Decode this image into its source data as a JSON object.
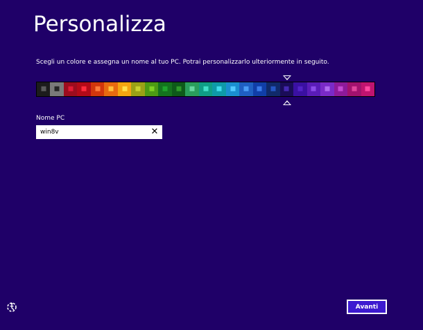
{
  "header": {
    "title": "Personalizza",
    "subtitle": "Scegli un colore e assegna un nome al tuo PC. Potrai personalizzarlo ulteriormente in seguito."
  },
  "palette": {
    "selected_index": 18,
    "swatches": [
      {
        "bg": "#1c1c1c",
        "chip": "#5a5a5a"
      },
      {
        "bg": "#7a7a7a",
        "chip": "#262626"
      },
      {
        "bg": "#9c0c1e",
        "chip": "#e01a34"
      },
      {
        "bg": "#b30a18",
        "chip": "#ff2a3c"
      },
      {
        "bg": "#d2360c",
        "chip": "#ff7a3a"
      },
      {
        "bg": "#e86a10",
        "chip": "#ffc03a"
      },
      {
        "bg": "#f4a511",
        "chip": "#ffe04a"
      },
      {
        "bg": "#9aa116",
        "chip": "#c8d22e"
      },
      {
        "bg": "#4c9a14",
        "chip": "#7ed022"
      },
      {
        "bg": "#14731e",
        "chip": "#1ea42c"
      },
      {
        "bg": "#0e5a1a",
        "chip": "#2e9a2a"
      },
      {
        "bg": "#2a9e5c",
        "chip": "#66d6a0"
      },
      {
        "bg": "#0f9e86",
        "chip": "#40e0c8"
      },
      {
        "bg": "#0e9aa8",
        "chip": "#40dcec"
      },
      {
        "bg": "#1a8fd0",
        "chip": "#52caff"
      },
      {
        "bg": "#1f5fc2",
        "chip": "#4a9cf6"
      },
      {
        "bg": "#103ea8",
        "chip": "#3a7ae8"
      },
      {
        "bg": "#102a6a",
        "chip": "#2456c2"
      },
      {
        "bg": "#1a0c58",
        "chip": "#4428b0"
      },
      {
        "bg": "#3a10a2",
        "chip": "#5222c6"
      },
      {
        "bg": "#5a1cb8",
        "chip": "#8a4ae8"
      },
      {
        "bg": "#7a2ac8",
        "chip": "#b06af0"
      },
      {
        "bg": "#8e1a9a",
        "chip": "#c448d2"
      },
      {
        "bg": "#a2126e",
        "chip": "#e0449c"
      },
      {
        "bg": "#c01470",
        "chip": "#ff48a2"
      }
    ]
  },
  "pc_name": {
    "label": "Nome PC",
    "value": "win8v",
    "clear_glyph": "✕"
  },
  "footer": {
    "next_label": "Avanti",
    "ease_of_access_icon": "ease-of-access-icon"
  }
}
